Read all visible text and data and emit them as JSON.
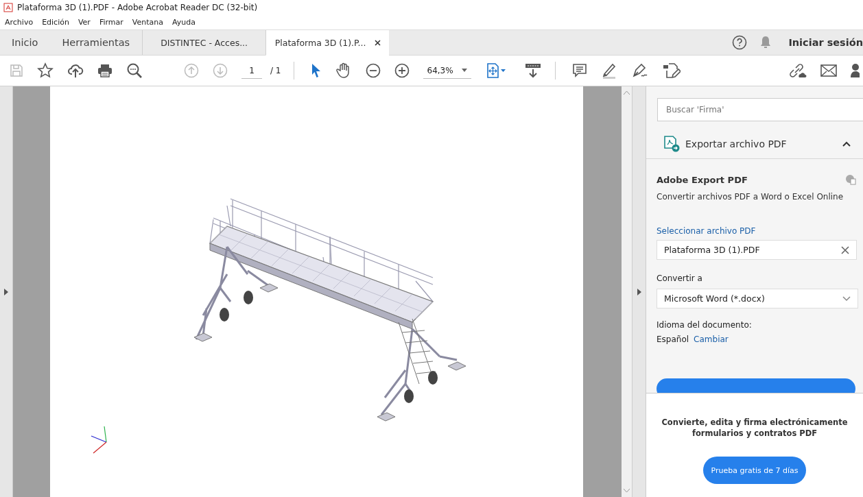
{
  "window": {
    "title": "Plataforma 3D (1).PDF - Adobe Acrobat Reader DC (32-bit)"
  },
  "menu": [
    "Archivo",
    "Edición",
    "Ver",
    "Firmar",
    "Ventana",
    "Ayuda"
  ],
  "tabs": [
    {
      "label": "Inicio",
      "kind": "nav",
      "selected": false
    },
    {
      "label": "Herramientas",
      "kind": "nav",
      "selected": false
    },
    {
      "label": "DISTINTEC - Acces...",
      "kind": "document",
      "selected": false
    },
    {
      "label": "Plataforma 3D (1).P...",
      "kind": "document",
      "selected": true
    }
  ],
  "header": {
    "sign_in": "Iniciar sesión"
  },
  "toolbar": {
    "save_disabled": true,
    "page_nav_disabled": true,
    "page": "1",
    "page_total": "/ 1",
    "zoom": "64,3%"
  },
  "side_panel": {
    "search": {
      "placeholder": "Buscar 'Firma'"
    },
    "section": {
      "title": "Exportar archivo PDF",
      "expanded": true
    },
    "heading": "Adobe Export PDF",
    "description": "Convertir archivos PDF a Word o Excel Online",
    "select_link": "Seleccionar archivo PDF",
    "file": {
      "value": "Plataforma 3D (1).PDF"
    },
    "convert_label": "Convertir a",
    "format": {
      "value": "Microsoft Word (*.docx)"
    },
    "language_label": "Idioma del documento:",
    "language": "Español",
    "change_link": "Cambiar",
    "promo": "Convierte, edita y firma electrónicamente formularios y contratos PDF",
    "trial_button": "Prueba gratis de 7 días"
  }
}
